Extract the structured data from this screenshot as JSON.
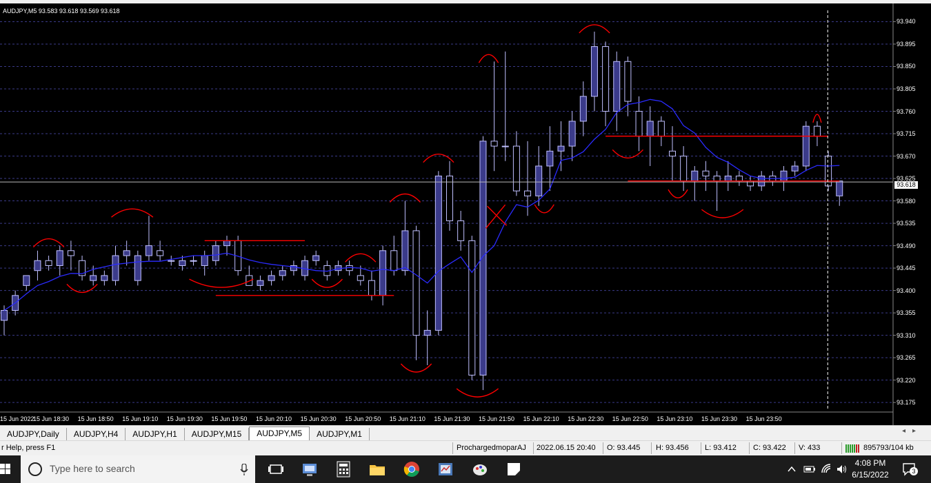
{
  "window": {
    "symbol_header": "AUDJPY,M5  93.583 93.618 93.569 93.618",
    "current_price": "93.618"
  },
  "chart_data": {
    "type": "candlestick",
    "symbol": "AUDJPY",
    "timeframe": "M5",
    "ylim": [
      93.16,
      93.96
    ],
    "y_ticks": [
      "93.940",
      "93.895",
      "93.850",
      "93.805",
      "93.760",
      "93.715",
      "93.670",
      "93.625",
      "93.580",
      "93.535",
      "93.490",
      "93.445",
      "93.400",
      "93.355",
      "93.310",
      "93.265",
      "93.220",
      "93.175"
    ],
    "x_ticks": [
      "15 Jun 2022",
      "15 Jun 18:30",
      "15 Jun 18:50",
      "15 Jun 19:10",
      "15 Jun 19:30",
      "15 Jun 19:50",
      "15 Jun 20:10",
      "15 Jun 20:30",
      "15 Jun 20:50",
      "15 Jun 21:10",
      "15 Jun 21:30",
      "15 Jun 21:50",
      "15 Jun 22:10",
      "15 Jun 22:30",
      "15 Jun 22:50",
      "15 Jun 23:10",
      "15 Jun 23:30",
      "15 Jun 23:50"
    ],
    "candles": [
      [
        93.34,
        93.37,
        93.31,
        93.36
      ],
      [
        93.36,
        93.4,
        93.35,
        93.39
      ],
      [
        93.41,
        93.43,
        93.4,
        93.43
      ],
      [
        93.44,
        93.48,
        93.42,
        93.46
      ],
      [
        93.46,
        93.47,
        93.44,
        93.45
      ],
      [
        93.45,
        93.49,
        93.43,
        93.48
      ],
      [
        93.48,
        93.5,
        93.44,
        93.47
      ],
      [
        93.46,
        93.47,
        93.42,
        93.43
      ],
      [
        93.42,
        93.45,
        93.41,
        93.43
      ],
      [
        93.42,
        93.44,
        93.41,
        93.43
      ],
      [
        93.42,
        93.49,
        93.41,
        93.47
      ],
      [
        93.47,
        93.5,
        93.45,
        93.48
      ],
      [
        93.42,
        93.48,
        93.41,
        93.47
      ],
      [
        93.47,
        93.55,
        93.46,
        93.49
      ],
      [
        93.48,
        93.5,
        93.46,
        93.47
      ],
      [
        93.46,
        93.47,
        93.45,
        93.46
      ],
      [
        93.45,
        93.47,
        93.44,
        93.46
      ],
      [
        93.46,
        93.47,
        93.45,
        93.46
      ],
      [
        93.45,
        93.48,
        93.43,
        93.47
      ],
      [
        93.46,
        93.5,
        93.45,
        93.49
      ],
      [
        93.49,
        93.51,
        93.47,
        93.5
      ],
      [
        93.5,
        93.51,
        93.43,
        93.44
      ],
      [
        93.43,
        93.45,
        93.42,
        93.41
      ],
      [
        93.41,
        93.43,
        93.4,
        93.42
      ],
      [
        93.42,
        93.44,
        93.41,
        93.43
      ],
      [
        93.43,
        93.45,
        93.42,
        93.44
      ],
      [
        93.44,
        93.46,
        93.43,
        93.45
      ],
      [
        93.43,
        93.47,
        93.42,
        93.46
      ],
      [
        93.46,
        93.48,
        93.45,
        93.47
      ],
      [
        93.45,
        93.46,
        93.42,
        93.43
      ],
      [
        93.44,
        93.46,
        93.43,
        93.45
      ],
      [
        93.45,
        93.46,
        93.43,
        93.44
      ],
      [
        93.43,
        93.45,
        93.41,
        93.42
      ],
      [
        93.42,
        93.44,
        93.38,
        93.39
      ],
      [
        93.39,
        93.49,
        93.37,
        93.48
      ],
      [
        93.48,
        93.51,
        93.43,
        93.44
      ],
      [
        93.44,
        93.58,
        93.43,
        93.52
      ],
      [
        93.52,
        93.53,
        93.26,
        93.31
      ],
      [
        93.31,
        93.36,
        93.25,
        93.32
      ],
      [
        93.32,
        93.64,
        93.31,
        93.63
      ],
      [
        93.63,
        93.66,
        93.52,
        93.54
      ],
      [
        93.54,
        93.56,
        93.48,
        93.5
      ],
      [
        93.5,
        93.51,
        93.22,
        93.23
      ],
      [
        93.23,
        93.71,
        93.2,
        93.7
      ],
      [
        93.7,
        93.86,
        93.64,
        93.69
      ],
      [
        93.69,
        93.88,
        93.66,
        93.69
      ],
      [
        93.69,
        93.72,
        93.59,
        93.6
      ],
      [
        93.6,
        93.7,
        93.55,
        93.59
      ],
      [
        93.59,
        93.69,
        93.57,
        93.65
      ],
      [
        93.65,
        93.73,
        93.6,
        93.68
      ],
      [
        93.68,
        93.74,
        93.64,
        93.69
      ],
      [
        93.69,
        93.76,
        93.66,
        93.74
      ],
      [
        93.74,
        93.82,
        93.71,
        93.79
      ],
      [
        93.79,
        93.92,
        93.76,
        93.89
      ],
      [
        93.89,
        93.9,
        93.73,
        93.76
      ],
      [
        93.76,
        93.88,
        93.72,
        93.86
      ],
      [
        93.86,
        93.87,
        93.75,
        93.78
      ],
      [
        93.76,
        93.79,
        93.68,
        93.71
      ],
      [
        93.71,
        93.77,
        93.65,
        93.74
      ],
      [
        93.74,
        93.75,
        93.69,
        93.71
      ],
      [
        93.68,
        93.73,
        93.62,
        93.67
      ],
      [
        93.67,
        93.69,
        93.6,
        93.62
      ],
      [
        93.62,
        93.65,
        93.58,
        93.64
      ],
      [
        93.64,
        93.66,
        93.6,
        93.63
      ],
      [
        93.63,
        93.64,
        93.56,
        93.62
      ],
      [
        93.62,
        93.66,
        93.6,
        93.63
      ],
      [
        93.63,
        93.64,
        93.61,
        93.62
      ],
      [
        93.62,
        93.63,
        93.6,
        93.61
      ],
      [
        93.61,
        93.64,
        93.6,
        93.63
      ],
      [
        93.63,
        93.64,
        93.61,
        93.62
      ],
      [
        93.62,
        93.65,
        93.6,
        93.64
      ],
      [
        93.64,
        93.66,
        93.63,
        93.65
      ],
      [
        93.65,
        93.74,
        93.64,
        93.73
      ],
      [
        93.73,
        93.74,
        93.69,
        93.71
      ],
      [
        93.67,
        93.68,
        93.6,
        93.61
      ],
      [
        93.59,
        93.62,
        93.57,
        93.62
      ]
    ],
    "colors": {
      "background": "#000000",
      "grid": "#3b3b8a",
      "candle_outline": "#c0c0ff",
      "candle_up_fill": "#3b3b8a",
      "candle_down_fill": "#000000",
      "moving_average": "#2b2bff",
      "drawings": "#ff0000"
    }
  },
  "tabs": [
    "AUDJPY,Daily",
    "AUDJPY,H4",
    "AUDJPY,H1",
    "AUDJPY,M15",
    "AUDJPY,M5",
    "AUDJPY,M1"
  ],
  "active_tab": "AUDJPY,M5",
  "status": {
    "help": "r Help, press F1",
    "profile": "ProchargedmoparAJ",
    "datetime": "2022.06.15 20:40",
    "open": "O: 93.445",
    "high": "H: 93.456",
    "low": "L: 93.412",
    "close": "C: 93.422",
    "volume": "V: 433",
    "traffic": "895793/104 kb"
  },
  "taskbar": {
    "search_placeholder": "Type here to search",
    "time": "4:08 PM",
    "date": "6/15/2022",
    "notification_count": "3"
  }
}
